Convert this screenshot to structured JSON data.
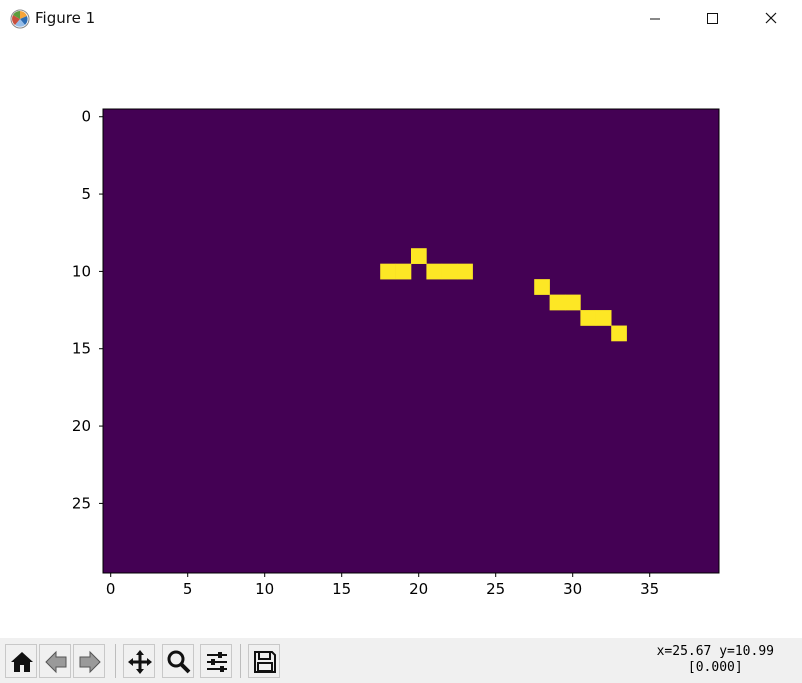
{
  "window": {
    "title": "Figure 1",
    "controls": {
      "minimize": "minimize",
      "maximize": "maximize",
      "close": "close"
    }
  },
  "chart_data": {
    "type": "heatmap",
    "colormap": "viridis",
    "nrows": 30,
    "ncols": 40,
    "background_value": 0.0,
    "highlight_value": 1.0,
    "colors": {
      "low": "#440154",
      "high": "#fde725"
    },
    "cells": [
      [
        9,
        20
      ],
      [
        10,
        18
      ],
      [
        10,
        19
      ],
      [
        10,
        21
      ],
      [
        10,
        22
      ],
      [
        10,
        23
      ],
      [
        11,
        28
      ],
      [
        12,
        29
      ],
      [
        12,
        30
      ],
      [
        13,
        31
      ],
      [
        13,
        32
      ],
      [
        14,
        33
      ]
    ],
    "x_ticks": [
      0,
      5,
      10,
      15,
      20,
      25,
      30,
      35
    ],
    "y_ticks": [
      0,
      5,
      10,
      15,
      20,
      25
    ],
    "xlim": [
      -0.5,
      39.5
    ],
    "ylim": [
      29.5,
      -0.5
    ],
    "title": "",
    "xlabel": "",
    "ylabel": ""
  },
  "toolbar": {
    "buttons": [
      "home",
      "back",
      "forward",
      "pan",
      "zoom",
      "configure-subplots",
      "save"
    ]
  },
  "status": {
    "coords": "x=25.67 y=10.99",
    "value": "[0.000]"
  }
}
